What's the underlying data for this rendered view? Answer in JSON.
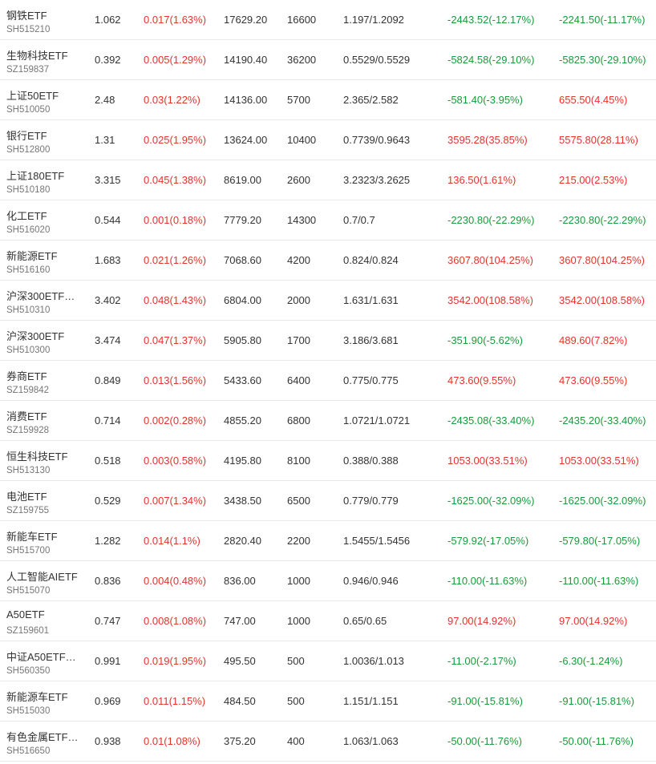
{
  "colors": {
    "up": "#e0352b",
    "down": "#1a9a3a",
    "text": "#333333",
    "code": "#777777",
    "divider": "#e8e8e8"
  },
  "rows": [
    {
      "name": "钢铁ETF",
      "code": "SH515210",
      "price": "1.062",
      "change": "0.017(1.63%)",
      "change_dir": "up",
      "value": "17629.20",
      "qty": "16600",
      "cost": "1.197/1.2092",
      "pl1": "-2443.52(-12.17%)",
      "pl1_dir": "down",
      "pl2": "-2241.50(-11.17%)",
      "pl2_dir": "down"
    },
    {
      "name": "生物科技ETF",
      "code": "SZ159837",
      "price": "0.392",
      "change": "0.005(1.29%)",
      "change_dir": "up",
      "value": "14190.40",
      "qty": "36200",
      "cost": "0.5529/0.5529",
      "pl1": "-5824.58(-29.10%)",
      "pl1_dir": "down",
      "pl2": "-5825.30(-29.10%)",
      "pl2_dir": "down"
    },
    {
      "name": "上证50ETF",
      "code": "SH510050",
      "price": "2.48",
      "change": "0.03(1.22%)",
      "change_dir": "up",
      "value": "14136.00",
      "qty": "5700",
      "cost": "2.365/2.582",
      "pl1": "-581.40(-3.95%)",
      "pl1_dir": "down",
      "pl2": "655.50(4.45%)",
      "pl2_dir": "up"
    },
    {
      "name": "银行ETF",
      "code": "SH512800",
      "price": "1.31",
      "change": "0.025(1.95%)",
      "change_dir": "up",
      "value": "13624.00",
      "qty": "10400",
      "cost": "0.7739/0.9643",
      "pl1": "3595.28(35.85%)",
      "pl1_dir": "up",
      "pl2": "5575.80(28.11%)",
      "pl2_dir": "up"
    },
    {
      "name": "上证180ETF",
      "code": "SH510180",
      "price": "3.315",
      "change": "0.045(1.38%)",
      "change_dir": "up",
      "value": "8619.00",
      "qty": "2600",
      "cost": "3.2323/3.2625",
      "pl1": "136.50(1.61%)",
      "pl1_dir": "up",
      "pl2": "215.00(2.53%)",
      "pl2_dir": "up"
    },
    {
      "name": "化工ETF",
      "code": "SH516020",
      "price": "0.544",
      "change": "0.001(0.18%)",
      "change_dir": "up",
      "value": "7779.20",
      "qty": "14300",
      "cost": "0.7/0.7",
      "pl1": "-2230.80(-22.29%)",
      "pl1_dir": "down",
      "pl2": "-2230.80(-22.29%)",
      "pl2_dir": "down"
    },
    {
      "name": "新能源ETF",
      "code": "SH516160",
      "price": "1.683",
      "change": "0.021(1.26%)",
      "change_dir": "up",
      "value": "7068.60",
      "qty": "4200",
      "cost": "0.824/0.824",
      "pl1": "3607.80(104.25%)",
      "pl1_dir": "up",
      "pl2": "3607.80(104.25%)",
      "pl2_dir": "up"
    },
    {
      "name": "沪深300ETF…",
      "code": "SH510310",
      "price": "3.402",
      "change": "0.048(1.43%)",
      "change_dir": "up",
      "value": "6804.00",
      "qty": "2000",
      "cost": "1.631/1.631",
      "pl1": "3542.00(108.58%)",
      "pl1_dir": "up",
      "pl2": "3542.00(108.58%)",
      "pl2_dir": "up"
    },
    {
      "name": "沪深300ETF",
      "code": "SH510300",
      "price": "3.474",
      "change": "0.047(1.37%)",
      "change_dir": "up",
      "value": "5905.80",
      "qty": "1700",
      "cost": "3.186/3.681",
      "pl1": "-351.90(-5.62%)",
      "pl1_dir": "down",
      "pl2": "489.60(7.82%)",
      "pl2_dir": "up"
    },
    {
      "name": "券商ETF",
      "code": "SZ159842",
      "price": "0.849",
      "change": "0.013(1.56%)",
      "change_dir": "up",
      "value": "5433.60",
      "qty": "6400",
      "cost": "0.775/0.775",
      "pl1": "473.60(9.55%)",
      "pl1_dir": "up",
      "pl2": "473.60(9.55%)",
      "pl2_dir": "up"
    },
    {
      "name": "消费ETF",
      "code": "SZ159928",
      "price": "0.714",
      "change": "0.002(0.28%)",
      "change_dir": "up",
      "value": "4855.20",
      "qty": "6800",
      "cost": "1.0721/1.0721",
      "pl1": "-2435.08(-33.40%)",
      "pl1_dir": "down",
      "pl2": "-2435.20(-33.40%)",
      "pl2_dir": "down"
    },
    {
      "name": "恒生科技ETF",
      "code": "SH513130",
      "price": "0.518",
      "change": "0.003(0.58%)",
      "change_dir": "up",
      "value": "4195.80",
      "qty": "8100",
      "cost": "0.388/0.388",
      "pl1": "1053.00(33.51%)",
      "pl1_dir": "up",
      "pl2": "1053.00(33.51%)",
      "pl2_dir": "up"
    },
    {
      "name": "电池ETF",
      "code": "SZ159755",
      "price": "0.529",
      "change": "0.007(1.34%)",
      "change_dir": "up",
      "value": "3438.50",
      "qty": "6500",
      "cost": "0.779/0.779",
      "pl1": "-1625.00(-32.09%)",
      "pl1_dir": "down",
      "pl2": "-1625.00(-32.09%)",
      "pl2_dir": "down"
    },
    {
      "name": "新能车ETF",
      "code": "SH515700",
      "price": "1.282",
      "change": "0.014(1.1%)",
      "change_dir": "up",
      "value": "2820.40",
      "qty": "2200",
      "cost": "1.5455/1.5456",
      "pl1": "-579.92(-17.05%)",
      "pl1_dir": "down",
      "pl2": "-579.80(-17.05%)",
      "pl2_dir": "down"
    },
    {
      "name": "人工智能AIETF",
      "code": "SH515070",
      "price": "0.836",
      "change": "0.004(0.48%)",
      "change_dir": "up",
      "value": "836.00",
      "qty": "1000",
      "cost": "0.946/0.946",
      "pl1": "-110.00(-11.63%)",
      "pl1_dir": "down",
      "pl2": "-110.00(-11.63%)",
      "pl2_dir": "down"
    },
    {
      "name": "A50ETF",
      "code": "SZ159601",
      "price": "0.747",
      "change": "0.008(1.08%)",
      "change_dir": "up",
      "value": "747.00",
      "qty": "1000",
      "cost": "0.65/0.65",
      "pl1": "97.00(14.92%)",
      "pl1_dir": "up",
      "pl2": "97.00(14.92%)",
      "pl2_dir": "up"
    },
    {
      "name": "中证A50ETF…",
      "code": "SH560350",
      "price": "0.991",
      "change": "0.019(1.95%)",
      "change_dir": "up",
      "value": "495.50",
      "qty": "500",
      "cost": "1.0036/1.013",
      "pl1": "-11.00(-2.17%)",
      "pl1_dir": "down",
      "pl2": "-6.30(-1.24%)",
      "pl2_dir": "down"
    },
    {
      "name": "新能源车ETF",
      "code": "SH515030",
      "price": "0.969",
      "change": "0.011(1.15%)",
      "change_dir": "up",
      "value": "484.50",
      "qty": "500",
      "cost": "1.151/1.151",
      "pl1": "-91.00(-15.81%)",
      "pl1_dir": "down",
      "pl2": "-91.00(-15.81%)",
      "pl2_dir": "down"
    },
    {
      "name": "有色金属ETF…",
      "code": "SH516650",
      "price": "0.938",
      "change": "0.01(1.08%)",
      "change_dir": "up",
      "value": "375.20",
      "qty": "400",
      "cost": "1.063/1.063",
      "pl1": "-50.00(-11.76%)",
      "pl1_dir": "down",
      "pl2": "-50.00(-11.76%)",
      "pl2_dir": "down"
    }
  ]
}
